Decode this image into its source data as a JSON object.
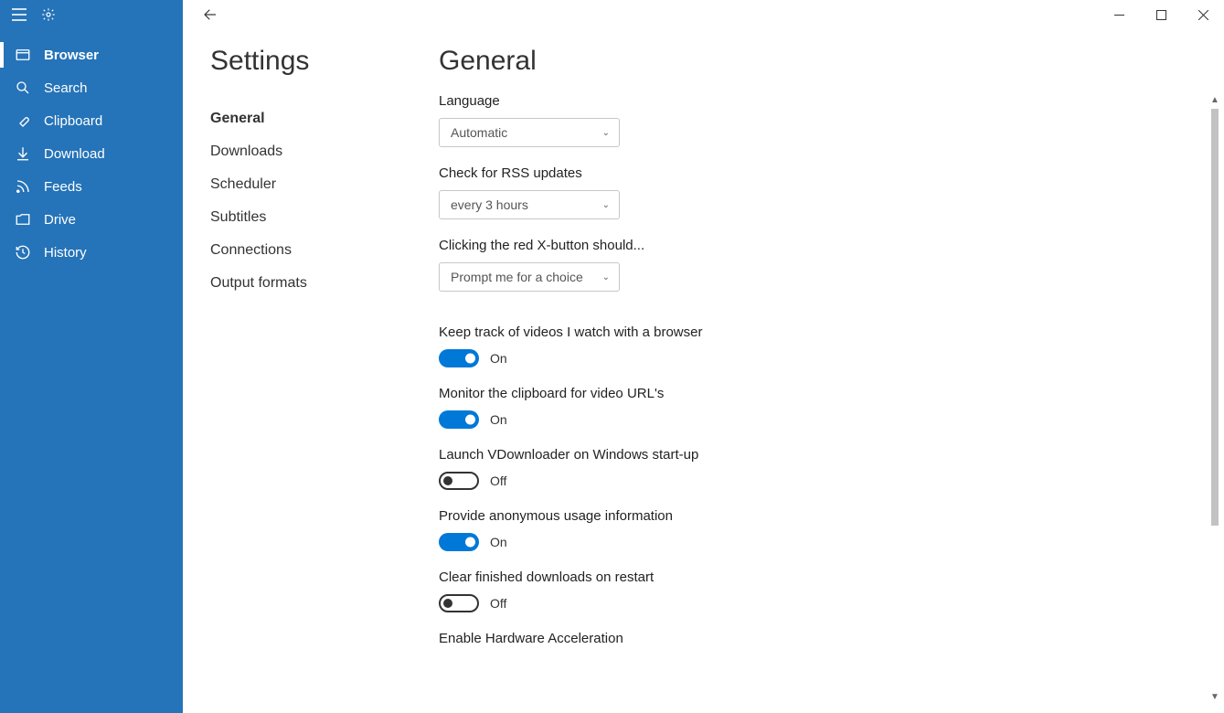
{
  "sidebar": {
    "items": [
      {
        "label": "Browser",
        "icon": "browser",
        "active": true
      },
      {
        "label": "Search",
        "icon": "search",
        "active": false
      },
      {
        "label": "Clipboard",
        "icon": "clipboard",
        "active": false
      },
      {
        "label": "Download",
        "icon": "download",
        "active": false
      },
      {
        "label": "Feeds",
        "icon": "feeds",
        "active": false
      },
      {
        "label": "Drive",
        "icon": "drive",
        "active": false
      },
      {
        "label": "History",
        "icon": "history",
        "active": false
      }
    ]
  },
  "settings": {
    "title": "Settings",
    "categories": [
      {
        "label": "General",
        "active": true
      },
      {
        "label": "Downloads",
        "active": false
      },
      {
        "label": "Scheduler",
        "active": false
      },
      {
        "label": "Subtitles",
        "active": false
      },
      {
        "label": "Connections",
        "active": false
      },
      {
        "label": "Output formats",
        "active": false
      }
    ]
  },
  "page": {
    "title": "General",
    "language": {
      "label": "Language",
      "value": "Automatic"
    },
    "rss": {
      "label": "Check for RSS updates",
      "value": "every 3 hours"
    },
    "close_action": {
      "label": "Clicking the red X-button should...",
      "value": "Prompt me for a choice"
    },
    "toggles": {
      "track_browser": {
        "label": "Keep track of videos I watch with a browser",
        "state": "On",
        "on": true
      },
      "monitor_clip": {
        "label": "Monitor the clipboard for video URL's",
        "state": "On",
        "on": true
      },
      "launch_startup": {
        "label": "Launch VDownloader on Windows start-up",
        "state": "Off",
        "on": false
      },
      "anon_usage": {
        "label": "Provide anonymous usage information",
        "state": "On",
        "on": true
      },
      "clear_finished": {
        "label": "Clear finished downloads on restart",
        "state": "Off",
        "on": false
      },
      "hw_accel": {
        "label": "Enable Hardware Acceleration"
      }
    }
  },
  "colors": {
    "sidebar_bg": "#2573b8",
    "accent": "#0078d7"
  }
}
